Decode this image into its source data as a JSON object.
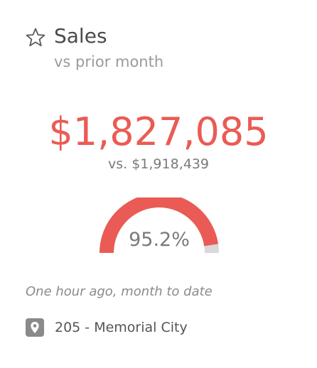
{
  "header": {
    "title": "Sales",
    "subtitle": "vs prior month",
    "favorite_icon": "star-outline-icon"
  },
  "metric": {
    "value": "$1,827,085",
    "comparison": "vs. $1,918,439",
    "percent_label": "95.2%",
    "percent_of_target": 0.952
  },
  "footer": {
    "freshness": "One hour ago, month to date",
    "location_icon": "map-pin-icon",
    "location": "205 - Memorial City"
  },
  "colors": {
    "accent": "#ea5b55",
    "gauge_track": "#d9d9d9",
    "title": "#4a4a4a",
    "muted": "#9a9a9a",
    "icon_box": "#8a8a8a"
  }
}
